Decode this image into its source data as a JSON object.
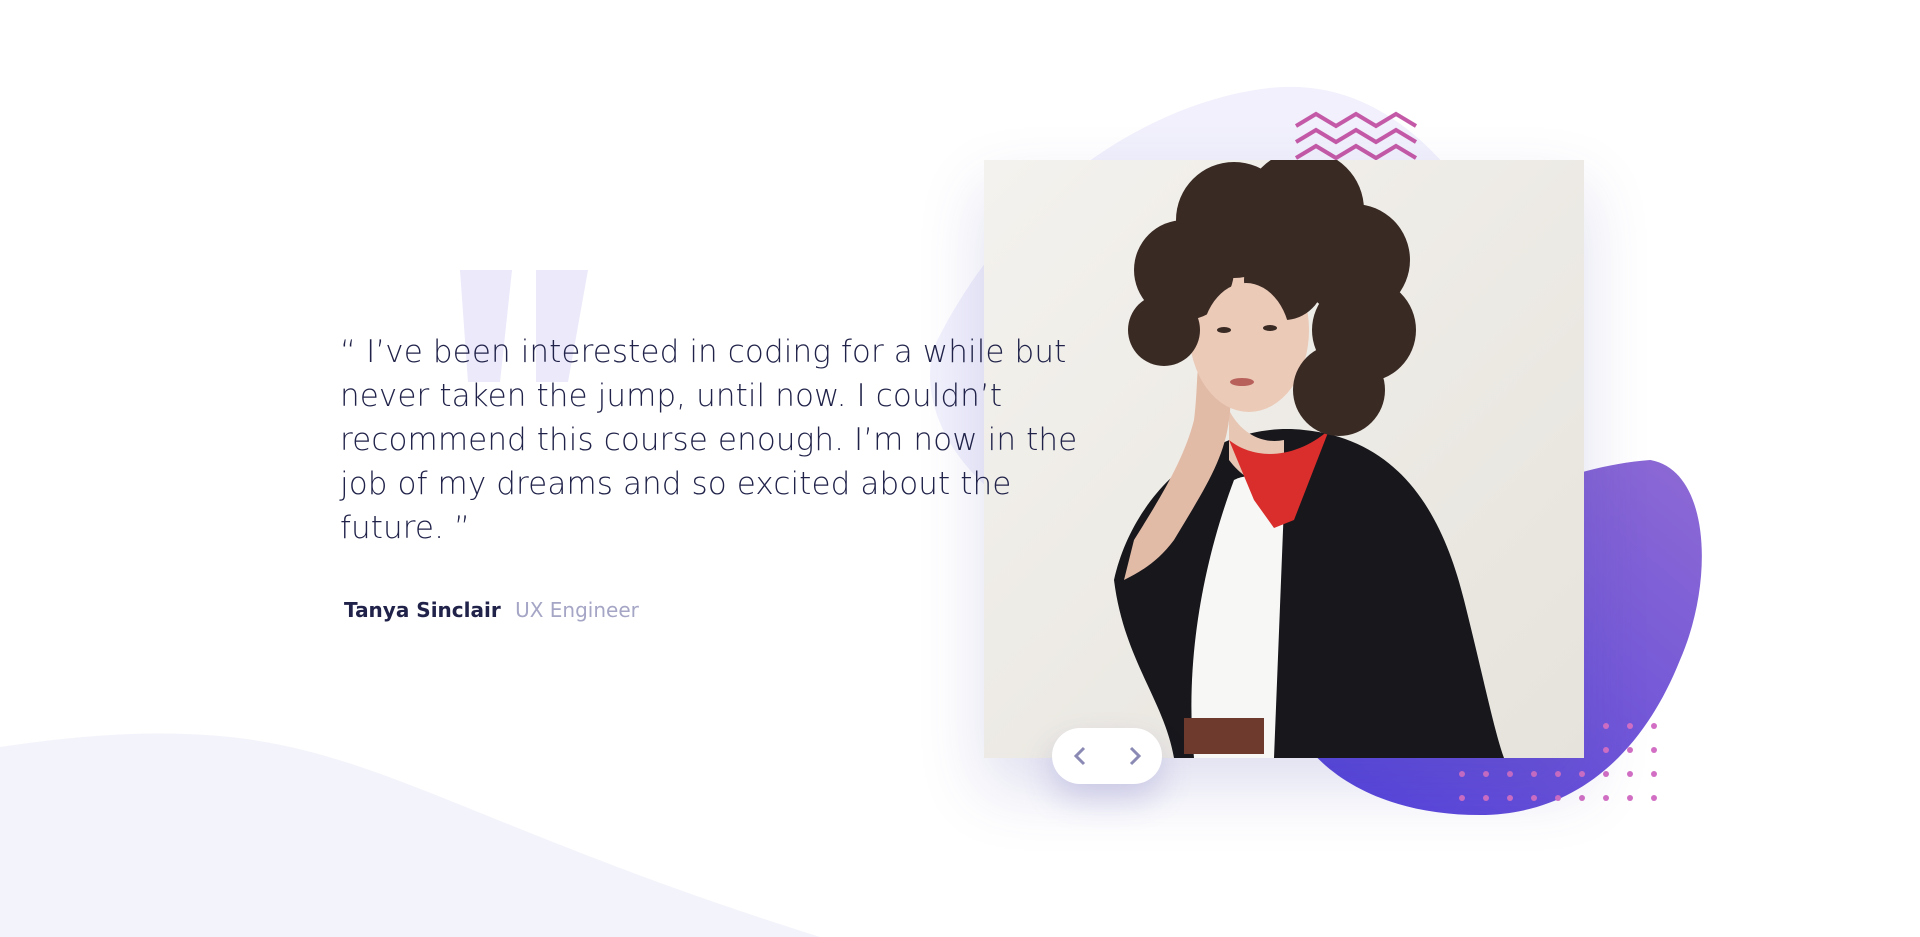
{
  "testimonial": {
    "quote": "“ I’ve been interested in coding for a while but never taken the jump, until now. I couldn’t recommend this course enough. I’m now in the job of my dreams and so excited about the future. ”",
    "author_name": "Tanya Sinclair",
    "author_role": "UX Engineer"
  },
  "slider": {
    "prev_icon": "chevron-left-icon",
    "next_icon": "chevron-right-icon"
  },
  "colors": {
    "text_dark": "#202249",
    "text_muted": "#a5a5c6",
    "bg_pale": "#f3f3fb",
    "quote_mark": "#ebe9fa",
    "accent_purple": "#6b4fd8",
    "accent_pink": "#c45aa7"
  }
}
